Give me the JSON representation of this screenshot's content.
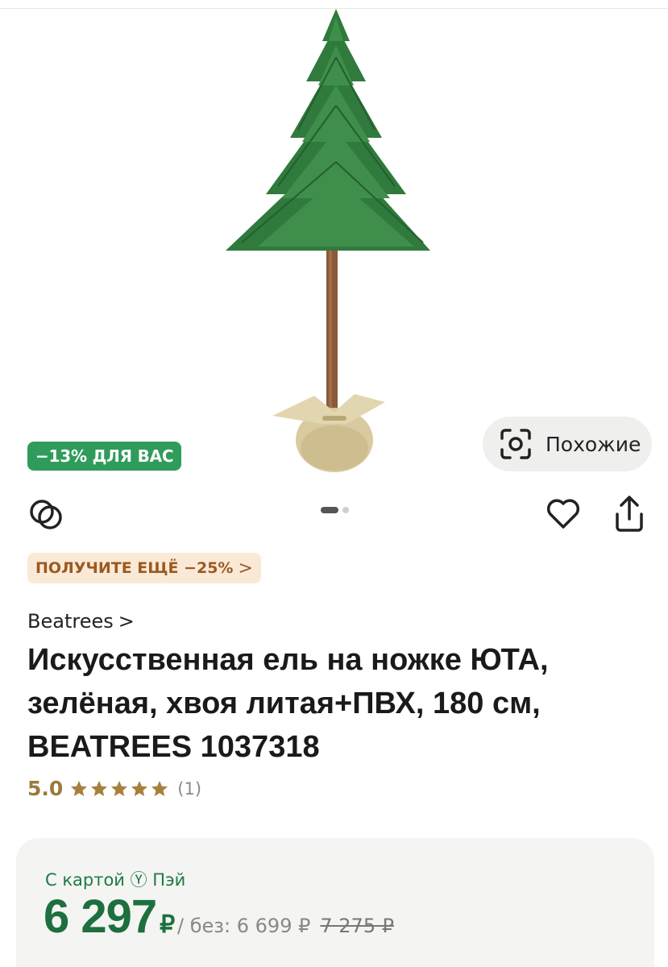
{
  "hero": {
    "discount_badge": "−13% ДЛЯ ВАС",
    "similar_button": "Похожие"
  },
  "actions": {
    "icons": [
      "compare-icon",
      "heart-icon",
      "share-icon"
    ],
    "gallery_pages": 2,
    "gallery_current": 1
  },
  "promo": {
    "label": "ПОЛУЧИТЕ ЕЩЁ −25%",
    "chevron": ">"
  },
  "product": {
    "brand": "Beatrees",
    "brand_chevron": ">",
    "title": "Искусственная ель на ножке ЮТА, зелёная, хвоя литая+ПВХ, 180 см, BEATREES 1037318",
    "rating": "5.0",
    "stars": 5,
    "reviews_count": "(1)"
  },
  "price": {
    "pay_label": "С картой Ⓨ Пэй",
    "current": "6 297",
    "currency": "₽",
    "without_card": "/ без: 6 699 ₽",
    "old": "7 275 ₽"
  },
  "colors": {
    "badge_green": "#2f9c5b",
    "price_green": "#1d6f3f",
    "promo_bg": "#fbe9d8",
    "promo_text": "#9b5a20",
    "star_gold": "#a8803e"
  }
}
